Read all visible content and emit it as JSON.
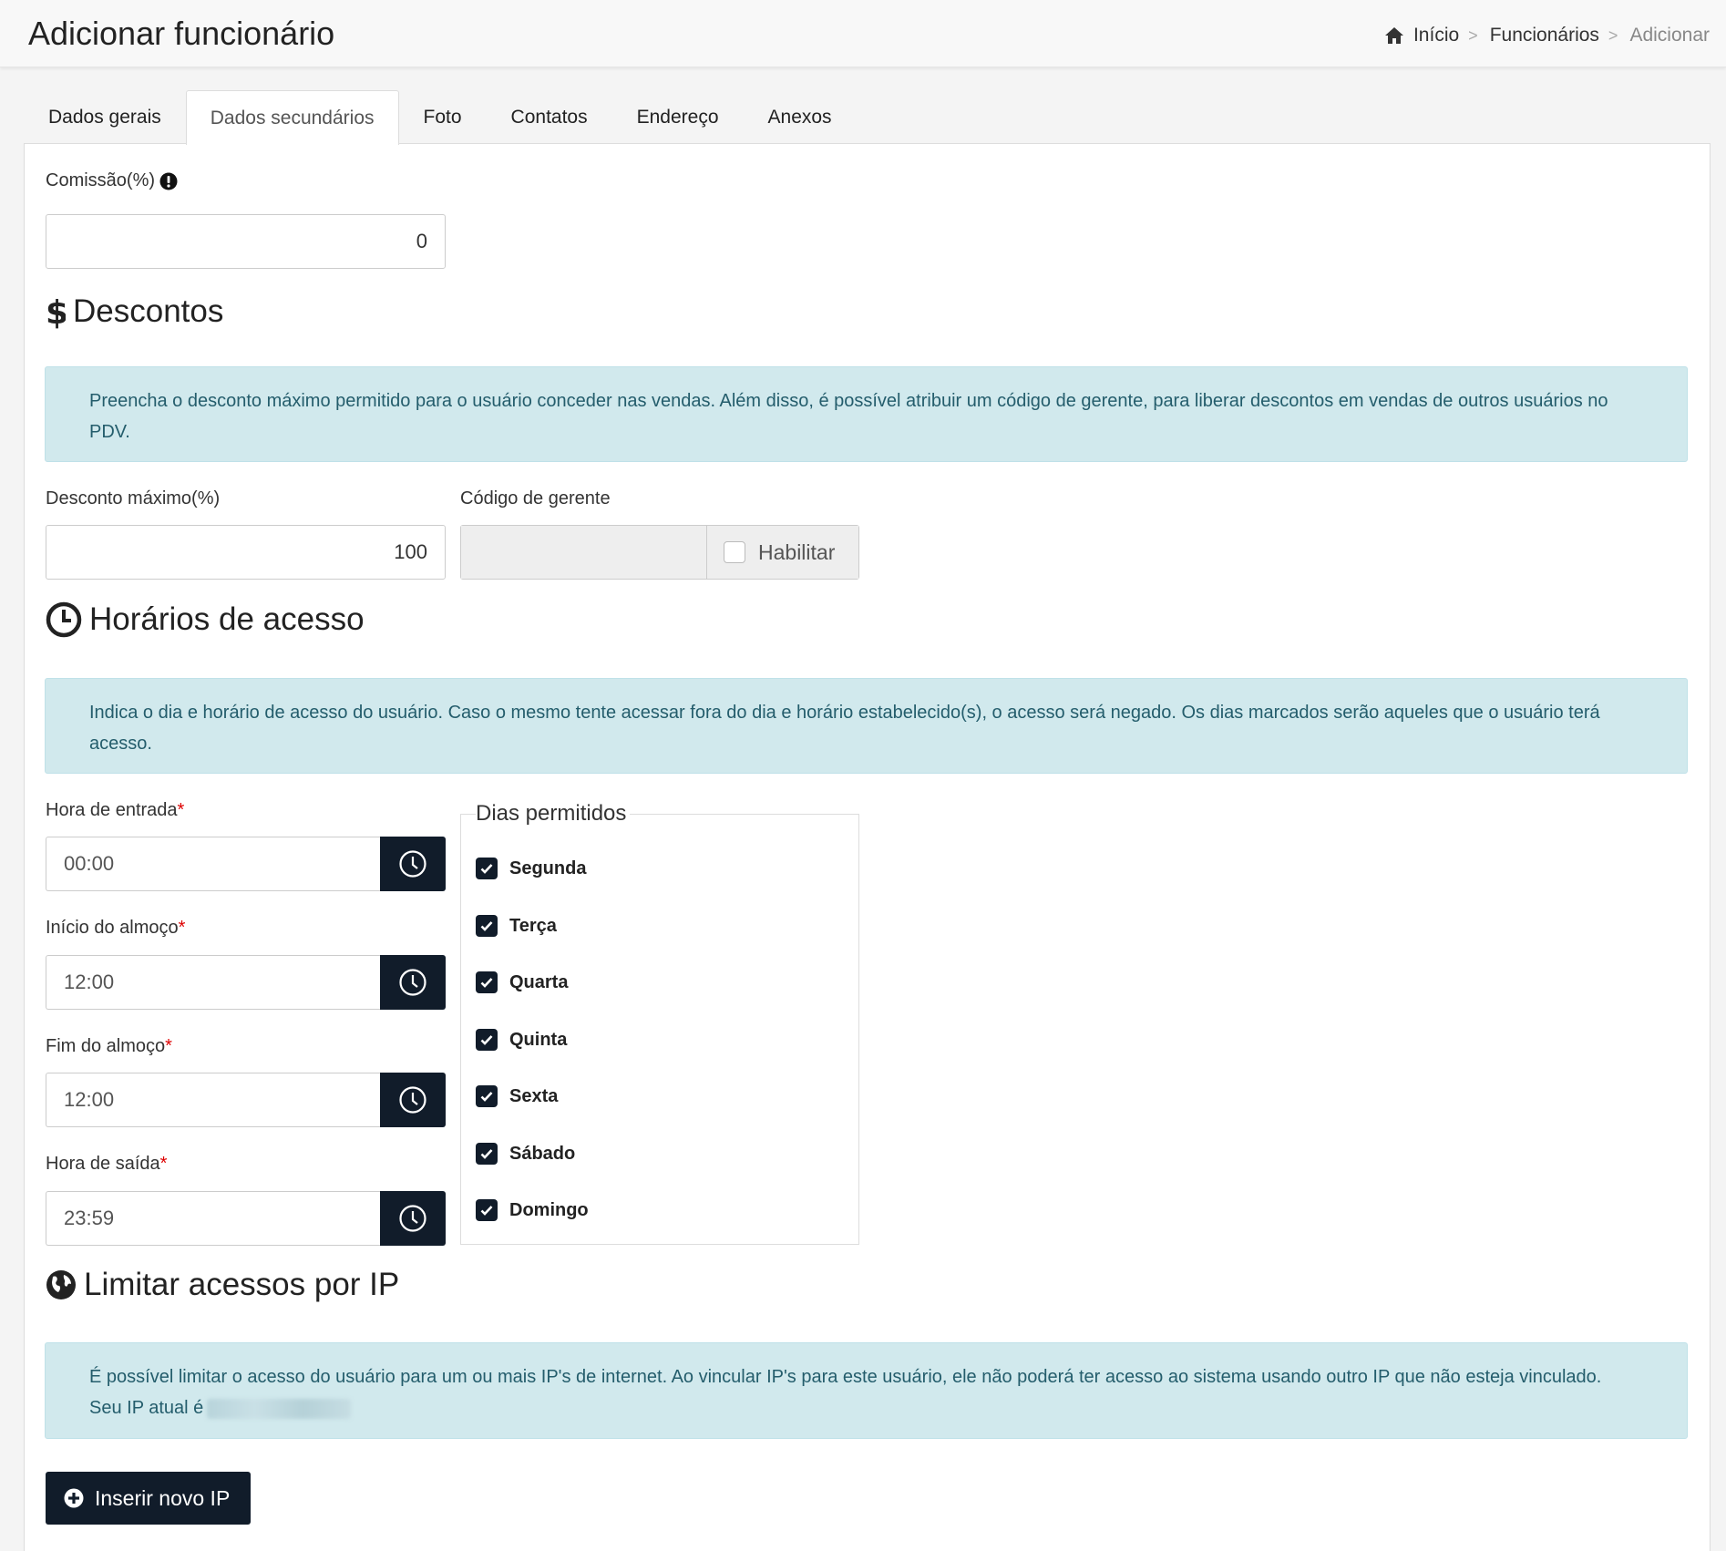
{
  "header": {
    "title": "Adicionar funcionário",
    "breadcrumb": [
      {
        "label": "Início",
        "icon": "home-icon"
      },
      {
        "label": "Funcionários"
      },
      {
        "label": "Adicionar"
      }
    ],
    "separator": ">"
  },
  "tabs": [
    {
      "label": "Dados gerais",
      "active": false
    },
    {
      "label": "Dados secundários",
      "active": true
    },
    {
      "label": "Foto",
      "active": false
    },
    {
      "label": "Contatos",
      "active": false
    },
    {
      "label": "Endereço",
      "active": false
    },
    {
      "label": "Anexos",
      "active": false
    }
  ],
  "comissao": {
    "label": "Comissão(%)",
    "icon": "exclamation-circle-icon",
    "value": "0"
  },
  "descontos": {
    "title": "Descontos",
    "icon": "dollar-icon",
    "info": "Preencha o desconto máximo permitido para o usuário conceder nas vendas. Além disso, é possível atribuir um código de gerente, para liberar descontos em vendas de outros usuários no PDV.",
    "desconto_maximo": {
      "label": "Desconto máximo(%)",
      "value": "100"
    },
    "codigo_gerente": {
      "label": "Código de gerente",
      "value": "",
      "habilitar_label": "Habilitar",
      "habilitar_checked": false
    }
  },
  "horarios": {
    "title": "Horários de acesso",
    "icon": "clock-icon",
    "info": "Indica o dia e horário de acesso do usuário. Caso o mesmo tente acessar fora do dia e horário estabelecido(s), o acesso será negado. Os dias marcados serão aqueles que o usuário terá acesso.",
    "required_mark": "*",
    "fields": [
      {
        "label": "Hora de entrada",
        "value": "00:00"
      },
      {
        "label": "Início do almoço",
        "value": "12:00"
      },
      {
        "label": "Fim do almoço",
        "value": "12:00"
      },
      {
        "label": "Hora de saída",
        "value": "23:59"
      }
    ],
    "dias_legend": "Dias permitidos",
    "dias": [
      {
        "label": "Segunda",
        "checked": true
      },
      {
        "label": "Terça",
        "checked": true
      },
      {
        "label": "Quarta",
        "checked": true
      },
      {
        "label": "Quinta",
        "checked": true
      },
      {
        "label": "Sexta",
        "checked": true
      },
      {
        "label": "Sábado",
        "checked": true
      },
      {
        "label": "Domingo",
        "checked": true
      }
    ]
  },
  "ip": {
    "title": "Limitar acessos por IP",
    "icon": "globe-icon",
    "info_line1": "É possível limitar o acesso do usuário para um ou mais IP's de internet. Ao vincular IP's para este usuário, ele não poderá ter acesso ao sistema usando outro IP que não esteja vinculado.",
    "info_line2": "Seu IP atual é",
    "button_label": "Inserir novo IP",
    "button_icon": "plus-circle-icon"
  },
  "colors": {
    "primary": "#111c2a",
    "alert_bg": "#d1e9ed",
    "alert_text": "#245d6c",
    "required": "#dd0000"
  }
}
